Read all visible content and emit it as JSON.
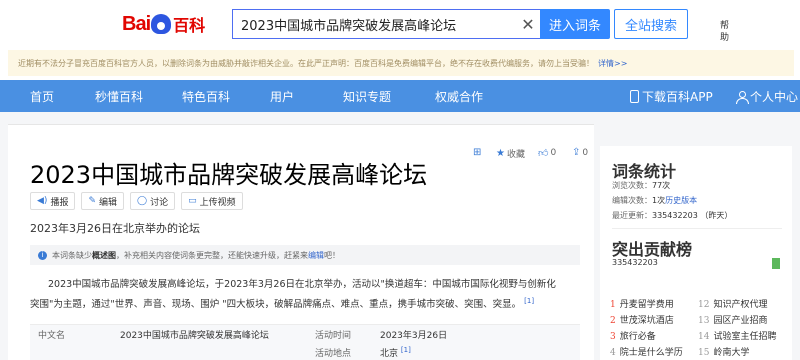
{
  "header": {
    "logo_text_1": "Bai",
    "logo_text_2": "百科",
    "search_value": "2023中国城市品牌突破发展高峰论坛",
    "enter_button": "进入词条",
    "search_all_button": "全站搜索",
    "help_text": "帮助"
  },
  "notice": {
    "text": "近期有不法分子冒充百度百科官方人员，以删除词条为由威胁并敲诈相关企业。在此严正声明：百度百科是免费编辑平台，绝不存在收费代编服务，请勿上当受骗！",
    "more": "详情>>"
  },
  "nav": {
    "items": [
      "首页",
      "秒懂百科",
      "特色百科",
      "用户",
      "知识专题",
      "权威合作"
    ],
    "download": "下载百科APP",
    "personal": "个人中心"
  },
  "article": {
    "title": "2023中国城市品牌突破发展高峰论坛",
    "tools": {
      "collect": "收藏",
      "like_count": "0",
      "share_count": "0"
    },
    "chips": [
      "播报",
      "编辑",
      "讨论",
      "上传视频"
    ],
    "subtitle": "2023年3月26日在北京举办的论坛",
    "tip": {
      "prefix": "本词条缺少",
      "bold": "概述图",
      "middle": "，补充相关内容使词条更完整，还能快速升级，赶紧来",
      "link": "编辑",
      "suffix": "吧！"
    },
    "paragraph": "2023中国城市品牌突破发展高峰论坛，于2023年3月26日在北京举办，活动以\"换道超车：中国城市国际化视野与创新化突围\"为主题，通过\"世界、声音、现场、围炉 \"四大板块，破解品牌痛点、难点、重点，携手城市突破、突围、突显。",
    "paragraph_ref": "[1]",
    "infobox": [
      {
        "k1": "中文名",
        "v1": "2023中国城市品牌突破发展高峰论坛",
        "k2": "活动时间",
        "v2": "2023年3月26日",
        "ref": ""
      },
      {
        "k1": "",
        "v1": "",
        "k2": "活动地点",
        "v2": "北京",
        "ref": "[1]"
      }
    ]
  },
  "sidebar": {
    "stats_title": "词条统计",
    "views_label": "浏览次数：",
    "views_value": "77次",
    "edits_label": "编辑次数：",
    "edits_value": "1次",
    "edits_link": "历史版本",
    "updated_label": "最近更新：",
    "updated_value": "335432203 （昨天）",
    "contrib_title": "突出贡献榜",
    "contrib_user": "335432203",
    "hot_list": [
      {
        "n": "1",
        "t": "丹麦留学费用"
      },
      {
        "n": "12",
        "t": "知识产权代理"
      },
      {
        "n": "2",
        "t": "世茂深坑酒店"
      },
      {
        "n": "13",
        "t": "园区产业招商"
      },
      {
        "n": "3",
        "t": "旅行必备"
      },
      {
        "n": "14",
        "t": "试验室主任招聘"
      },
      {
        "n": "4",
        "t": "院士是什么学历"
      },
      {
        "n": "15",
        "t": "岭南大学"
      }
    ]
  }
}
